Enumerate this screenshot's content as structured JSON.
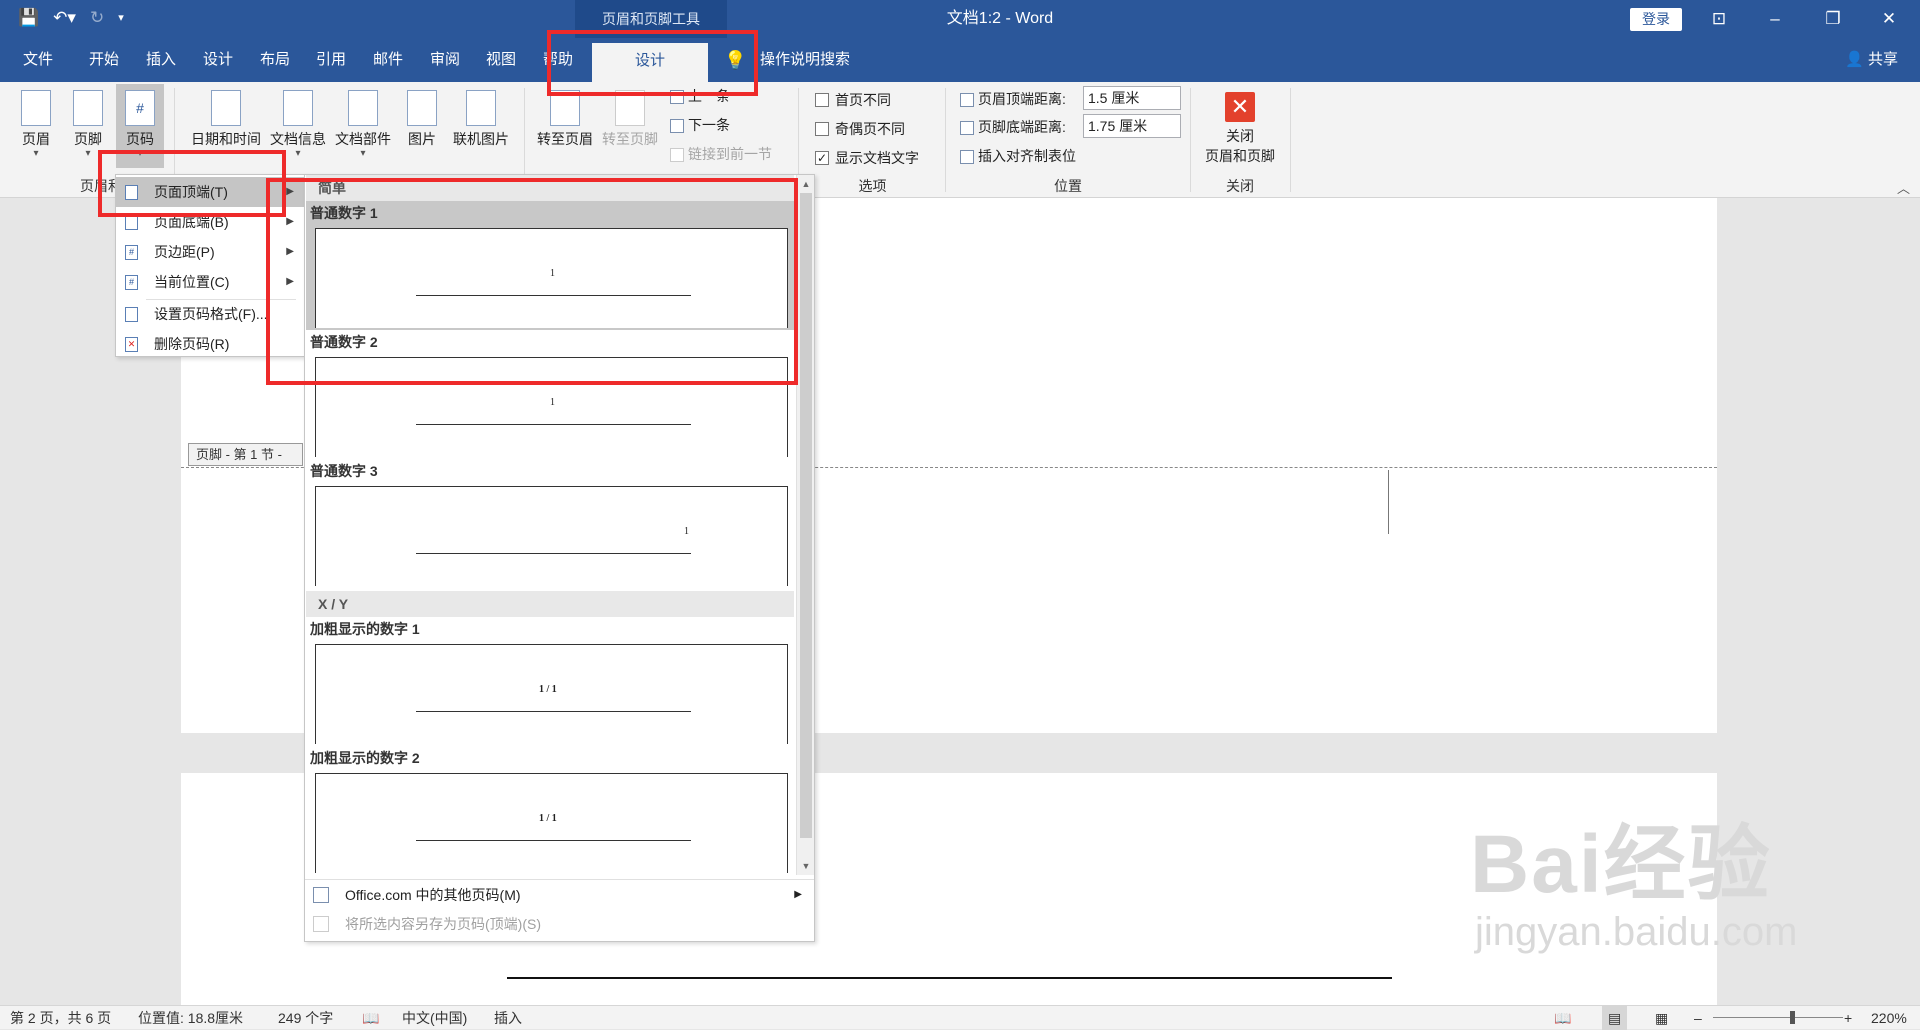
{
  "titlebar": {
    "contextual_tool": "页眉和页脚工具",
    "document_title": "文档1:2 - Word",
    "login": "登录",
    "win_buttons": [
      "⊡",
      "–",
      "❐",
      "✕"
    ]
  },
  "tabs": {
    "items": [
      "文件",
      "开始",
      "插入",
      "设计",
      "布局",
      "引用",
      "邮件",
      "审阅",
      "视图",
      "帮助"
    ],
    "active": "设计",
    "tell_me": "操作说明搜索",
    "share": "共享"
  },
  "ribbon": {
    "buttons": {
      "header": "页眉",
      "footer": "页脚",
      "page_number": "页码",
      "date_time": "日期和时间",
      "doc_info": "文档信息",
      "doc_parts": "文档部件",
      "picture": "图片",
      "online_picture": "联机图片",
      "goto_header": "转至页眉",
      "goto_footer": "转至页脚",
      "previous": "上一条",
      "next": "下一条",
      "link_previous": "链接到前一节",
      "close_line1": "关闭",
      "close_line2": "页眉和页脚"
    },
    "groups": {
      "header_footer": "页眉和页脚",
      "options": "选项",
      "position": "位置",
      "close": "关闭"
    },
    "options": {
      "different_first": {
        "label": "首页不同",
        "checked": false
      },
      "different_odd_even": {
        "label": "奇偶页不同",
        "checked": false
      },
      "show_doc_text": {
        "label": "显示文档文字",
        "checked": true
      }
    },
    "position": {
      "header_from_top_label": "页眉顶端距离:",
      "header_from_top_value": "1.5 厘米",
      "footer_from_bottom_label": "页脚底端距离:",
      "footer_from_bottom_value": "1.75 厘米",
      "insert_alignment_tab": "插入对齐制表位"
    }
  },
  "document": {
    "footer_tag": "页脚 - 第 1 节 -"
  },
  "page_number_menu": {
    "items": [
      "页面顶端(T)",
      "页面底端(B)",
      "页边距(P)",
      "当前位置(C)",
      "设置页码格式(F)...",
      "删除页码(R)"
    ],
    "highlighted": "页面顶端(T)"
  },
  "gallery": {
    "category_simple": "简单",
    "category_xy": "X / Y",
    "items": [
      {
        "label": "普通数字 1",
        "preview": "1",
        "align": "center",
        "bold": false
      },
      {
        "label": "普通数字 2",
        "preview": "1",
        "align": "center",
        "bold": false
      },
      {
        "label": "普通数字 3",
        "preview": "1",
        "align": "right",
        "bold": false
      },
      {
        "label": "加粗显示的数字 1",
        "preview": "1 / 1",
        "align": "center",
        "bold": true
      },
      {
        "label": "加粗显示的数字 2",
        "preview": "1 / 1",
        "align": "center",
        "bold": true
      }
    ],
    "selected": "普通数字 1",
    "more_from_office": "Office.com 中的其他页码(M)",
    "save_selection": "将所选内容另存为页码(顶端)(S)"
  },
  "status_bar": {
    "page": "第 2 页，共 6 页",
    "position": "位置值: 18.8厘米",
    "words": "249 个字",
    "language": "中文(中国)",
    "mode": "插入",
    "zoom": "220%"
  },
  "watermark": {
    "brand": "Bai经验",
    "url": "jingyan.baidu.com"
  },
  "colors": {
    "title_blue": "#2b579a",
    "highlight_red": "#ee2a2a",
    "ribbon_bg": "#f3f3f3"
  }
}
